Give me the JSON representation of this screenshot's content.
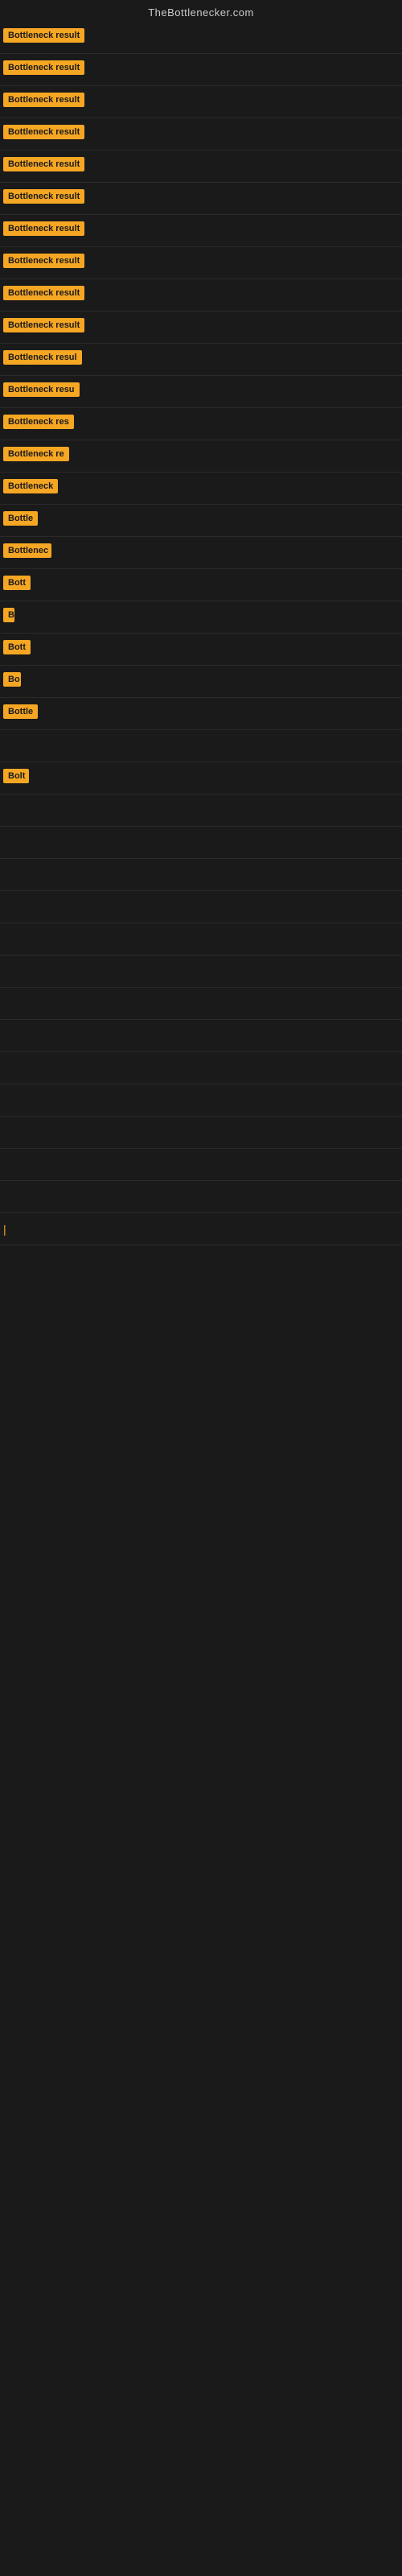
{
  "header": {
    "title": "TheBottlenecker.com"
  },
  "rows": [
    {
      "id": 1,
      "label": "Bottleneck result",
      "width": 120
    },
    {
      "id": 2,
      "label": "Bottleneck result",
      "width": 120
    },
    {
      "id": 3,
      "label": "Bottleneck result",
      "width": 120
    },
    {
      "id": 4,
      "label": "Bottleneck result",
      "width": 120
    },
    {
      "id": 5,
      "label": "Bottleneck result",
      "width": 120
    },
    {
      "id": 6,
      "label": "Bottleneck result",
      "width": 120
    },
    {
      "id": 7,
      "label": "Bottleneck result",
      "width": 120
    },
    {
      "id": 8,
      "label": "Bottleneck result",
      "width": 120
    },
    {
      "id": 9,
      "label": "Bottleneck result",
      "width": 120
    },
    {
      "id": 10,
      "label": "Bottleneck result",
      "width": 120
    },
    {
      "id": 11,
      "label": "Bottleneck resul",
      "width": 108
    },
    {
      "id": 12,
      "label": "Bottleneck resu",
      "width": 100
    },
    {
      "id": 13,
      "label": "Bottleneck res",
      "width": 92
    },
    {
      "id": 14,
      "label": "Bottleneck re",
      "width": 85
    },
    {
      "id": 15,
      "label": "Bottleneck",
      "width": 72
    },
    {
      "id": 16,
      "label": "Bottle",
      "width": 45
    },
    {
      "id": 17,
      "label": "Bottlenec",
      "width": 60
    },
    {
      "id": 18,
      "label": "Bott",
      "width": 35
    },
    {
      "id": 19,
      "label": "B",
      "width": 14
    },
    {
      "id": 20,
      "label": "Bott",
      "width": 35
    },
    {
      "id": 21,
      "label": "Bo",
      "width": 22
    },
    {
      "id": 22,
      "label": "Bottle",
      "width": 45
    },
    {
      "id": 23,
      "label": "",
      "width": 0
    },
    {
      "id": 24,
      "label": "Bolt",
      "width": 32
    },
    {
      "id": 25,
      "label": "",
      "width": 0
    },
    {
      "id": 26,
      "label": "",
      "width": 0
    },
    {
      "id": 27,
      "label": "",
      "width": 0
    },
    {
      "id": 28,
      "label": "",
      "width": 0
    },
    {
      "id": 29,
      "label": "",
      "width": 0
    },
    {
      "id": 30,
      "label": "",
      "width": 0
    },
    {
      "id": 31,
      "label": "",
      "width": 0
    },
    {
      "id": 32,
      "label": "",
      "width": 0
    },
    {
      "id": 33,
      "label": "",
      "width": 0
    },
    {
      "id": 34,
      "label": "",
      "width": 0
    },
    {
      "id": 35,
      "label": "",
      "width": 0
    },
    {
      "id": 36,
      "label": "",
      "width": 0
    },
    {
      "id": 37,
      "label": "",
      "width": 0
    },
    {
      "id": 38,
      "label": "|",
      "width": 8
    }
  ]
}
